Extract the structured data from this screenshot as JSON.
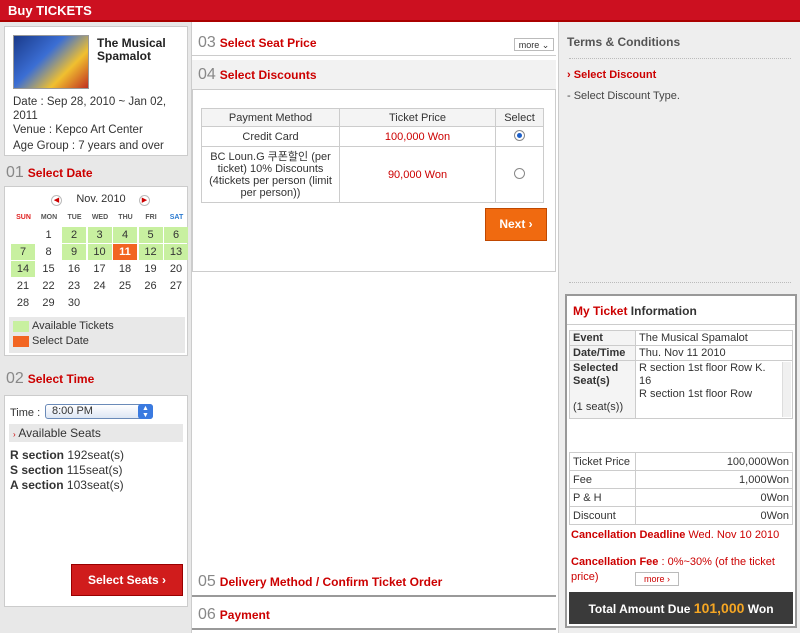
{
  "header": {
    "title": "Buy TICKETS"
  },
  "show": {
    "title": "The Musical Spamalot",
    "date": "Date : Sep 28, 2010 ~ Jan 02, 2011",
    "venue": "Venue : Kepco Art Center",
    "age": "Age Group : 7 years and over"
  },
  "steps": {
    "s01": {
      "num": "01",
      "label": "Select Date"
    },
    "s02": {
      "num": "02",
      "label": "Select Time"
    },
    "s03": {
      "num": "03",
      "label": "Select Seat Price"
    },
    "s04": {
      "num": "04",
      "label": "Select Discounts"
    },
    "s05": {
      "num": "05",
      "label": "Delivery Method / Confirm Ticket Order"
    },
    "s06": {
      "num": "06",
      "label": "Payment"
    }
  },
  "calendar": {
    "month": "Nov. 2010",
    "prev": "◀",
    "next": "▶",
    "dows": [
      "SUN",
      "MON",
      "TUE",
      "WED",
      "THU",
      "FRI",
      "SAT"
    ],
    "dow_colors": [
      "#e02020",
      "#555",
      "#555",
      "#555",
      "#555",
      "#555",
      "#2a7ad0"
    ],
    "days": [
      [
        {
          "d": ""
        },
        {
          "d": "1"
        },
        {
          "d": "2",
          "s": "av"
        },
        {
          "d": "3",
          "s": "av"
        },
        {
          "d": "4",
          "s": "av"
        },
        {
          "d": "5",
          "s": "av"
        },
        {
          "d": "6",
          "s": "av"
        }
      ],
      [
        {
          "d": "7",
          "s": "av"
        },
        {
          "d": "8"
        },
        {
          "d": "9",
          "s": "av"
        },
        {
          "d": "10",
          "s": "av"
        },
        {
          "d": "11",
          "s": "sel"
        },
        {
          "d": "12",
          "s": "av"
        },
        {
          "d": "13",
          "s": "av"
        }
      ],
      [
        {
          "d": "14",
          "s": "av"
        },
        {
          "d": "15"
        },
        {
          "d": "16"
        },
        {
          "d": "17"
        },
        {
          "d": "18"
        },
        {
          "d": "19"
        },
        {
          "d": "20"
        }
      ],
      [
        {
          "d": "21"
        },
        {
          "d": "22"
        },
        {
          "d": "23"
        },
        {
          "d": "24"
        },
        {
          "d": "25"
        },
        {
          "d": "26"
        },
        {
          "d": "27"
        }
      ],
      [
        {
          "d": "28"
        },
        {
          "d": "29"
        },
        {
          "d": "30"
        },
        {
          "d": ""
        },
        {
          "d": ""
        },
        {
          "d": ""
        },
        {
          "d": ""
        }
      ]
    ],
    "legend_available": "Available Tickets",
    "legend_selected": "Select Date",
    "color_available": "#c8f0a0",
    "color_selected": "#f26522"
  },
  "time": {
    "label": "Time :",
    "value": "8:00 PM",
    "available_label": "Available Seats",
    "sections": [
      {
        "name": "R section",
        "seats": "192seat(s)"
      },
      {
        "name": "S section",
        "seats": "115seat(s)"
      },
      {
        "name": "A section",
        "seats": "103seat(s)"
      }
    ],
    "button": "Select Seats"
  },
  "seatprice": {
    "more": "more"
  },
  "discounts": {
    "headers": [
      "Payment Method",
      "Ticket Price",
      "Select"
    ],
    "rows": [
      {
        "method": "Credit Card",
        "price": "100,000 Won",
        "selected": true
      },
      {
        "method": "BC Loun.G 쿠폰할인 (per ticket) 10% Discounts (4tickets per person (limit per person))",
        "price": "90,000 Won",
        "selected": false
      }
    ],
    "next": "Next"
  },
  "terms": {
    "title": "Terms & Conditions",
    "heading": "Select Discount",
    "text": "- Select Discount Type."
  },
  "myticket": {
    "title_red": "My Ticket",
    "title_rest": " Information",
    "event_label": "Event",
    "event": "The Musical Spamalot",
    "datetime_label": "Date/Time",
    "datetime": "Thu. Nov 11 2010",
    "seats_label": "Selected Seat(s)",
    "seats_count": "(1 seat(s))",
    "seat1": "R section 1st floor Row K. 16",
    "seat2": "R section 1st floor Row",
    "fees": [
      {
        "label": "Ticket Price",
        "value": "100,000Won"
      },
      {
        "label": "Fee",
        "value": "1,000Won"
      },
      {
        "label": "P & H",
        "value": "0Won"
      },
      {
        "label": "Discount",
        "value": "0Won"
      }
    ],
    "deadline_label": "Cancellation Deadline",
    "deadline": "Wed. Nov 10 2010",
    "fee_label": "Cancellation Fee",
    "fee_text": " : 0%~30% (of the ticket price)",
    "more": "more",
    "total_label": "Total Amount Due",
    "total_value": "101,000",
    "total_unit": "Won"
  }
}
